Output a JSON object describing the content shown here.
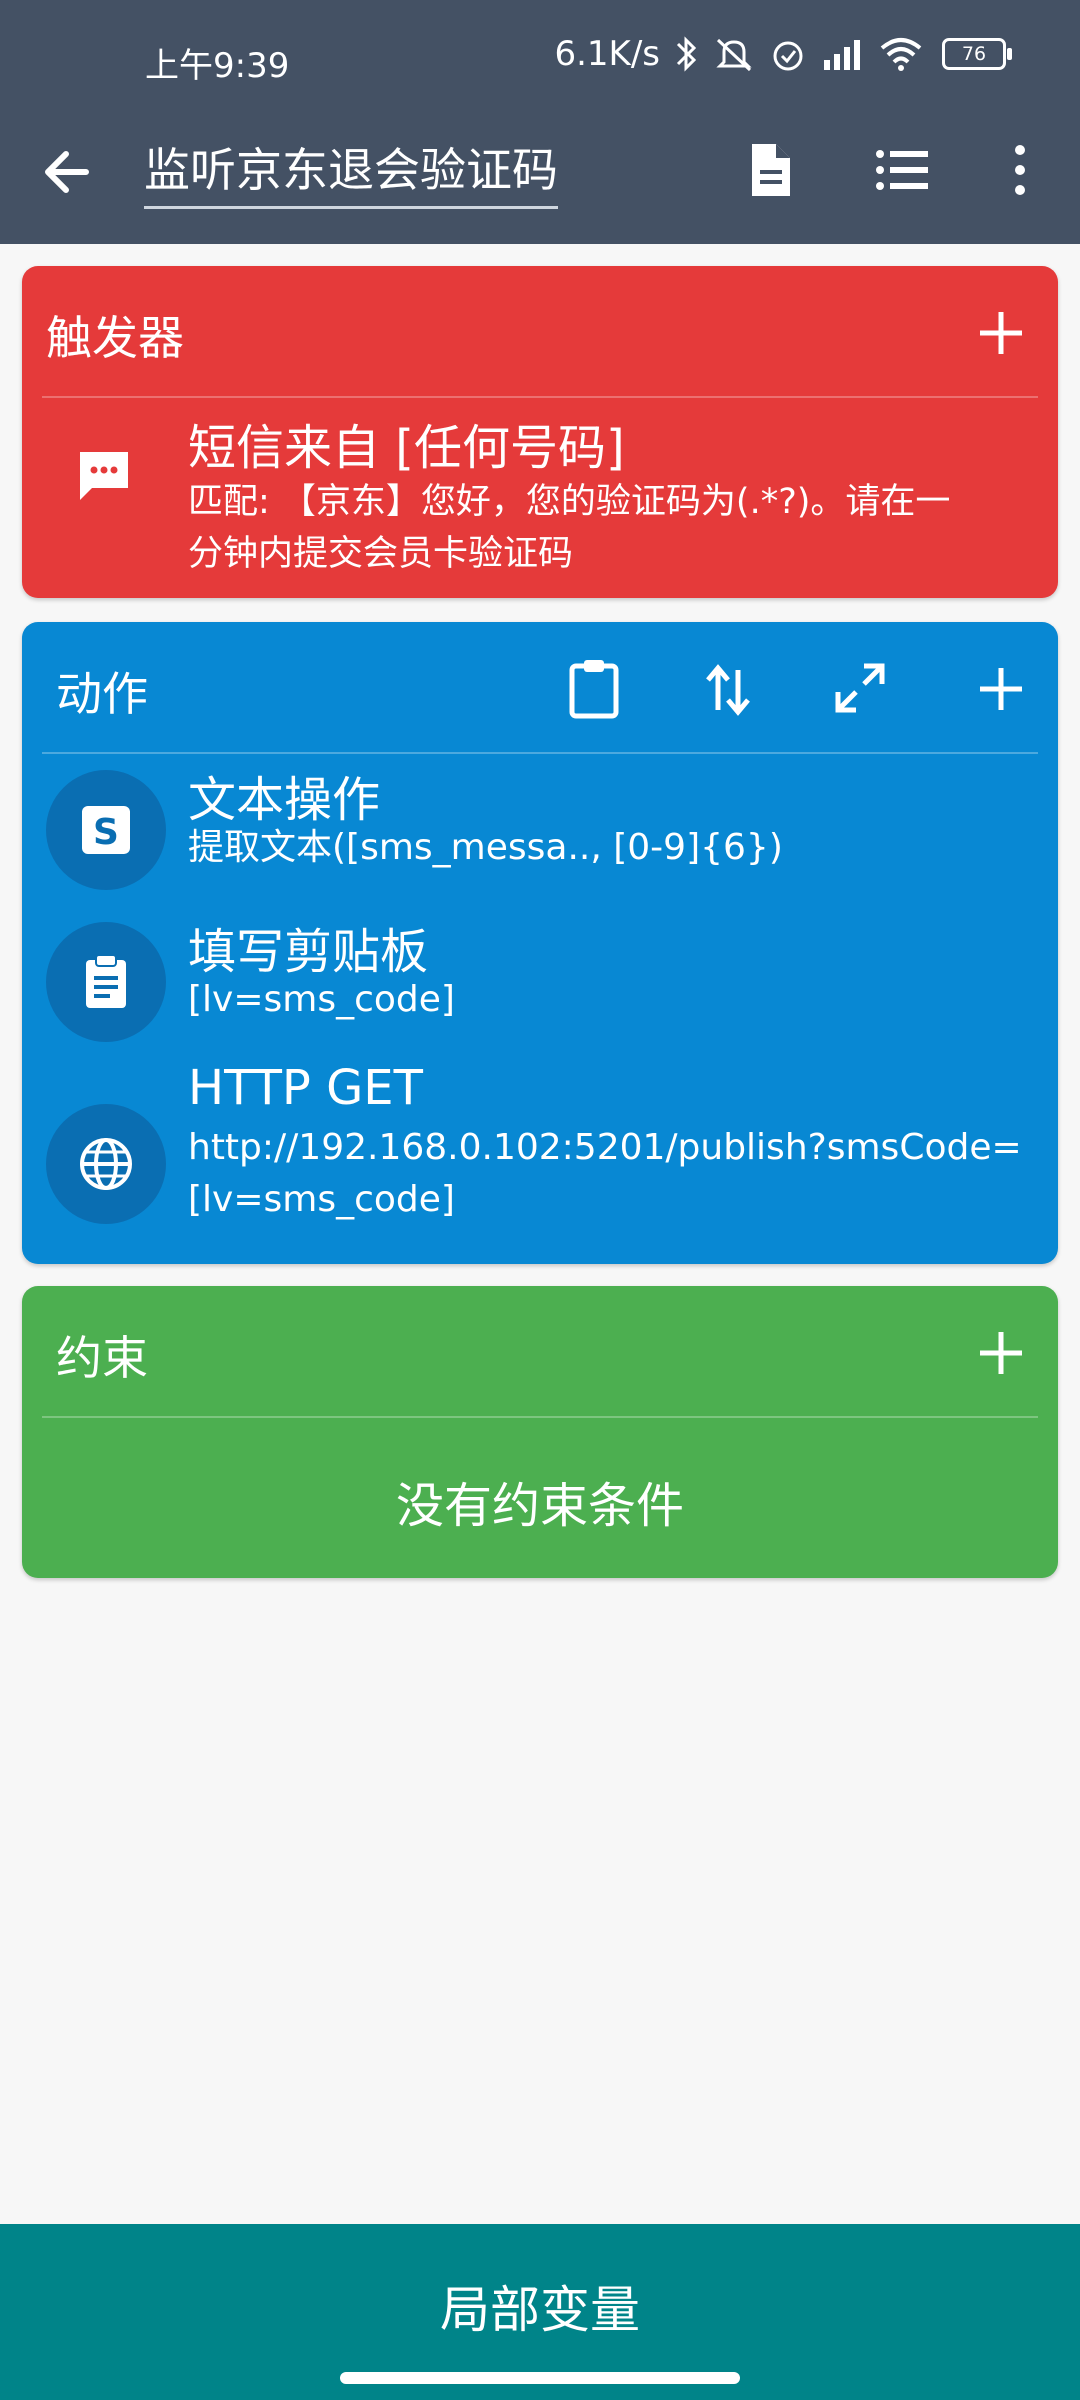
{
  "status_bar": {
    "time": "上午9:39",
    "net_speed": "6.1K/s",
    "battery": "76",
    "icons": [
      "bluetooth-icon",
      "mute-icon",
      "alarm-icon",
      "signal-icon",
      "wifi-icon",
      "battery-icon"
    ]
  },
  "header": {
    "title": "监听京东退会验证码",
    "actions": [
      "document-icon",
      "list-icon",
      "more-vert-icon"
    ]
  },
  "trigger_card": {
    "title": "触发器",
    "color": "#e53a3a",
    "item": {
      "title": "短信来自 [任何号码]",
      "detail_line1": "匹配: 【京东】您好，您的验证码为(.*?)。请在一",
      "detail_line2": "分钟内提交会员卡验证码",
      "icon": "sms-icon"
    }
  },
  "action_card": {
    "title": "动作",
    "color": "#0888d3",
    "tools": [
      "clipboard-icon",
      "reorder-icon",
      "expand-icon",
      "add-icon"
    ],
    "items": [
      {
        "title": "文本操作",
        "detail": "提取文本([sms_messa.., [0-9]{6})",
        "icon": "text-manipulation-icon"
      },
      {
        "title": "填写剪贴板",
        "detail": "[lv=sms_code]",
        "icon": "clipboard-text-icon"
      },
      {
        "title": "HTTP GET",
        "detail_line1": "http://192.168.0.102:5201/publish?smsCode=",
        "detail_line2": "[lv=sms_code]",
        "icon": "globe-icon"
      }
    ]
  },
  "constraint_card": {
    "title": "约束",
    "color": "#4caf50",
    "empty_text": "没有约束条件"
  },
  "footer": {
    "label": "局部变量",
    "color": "#008489"
  }
}
